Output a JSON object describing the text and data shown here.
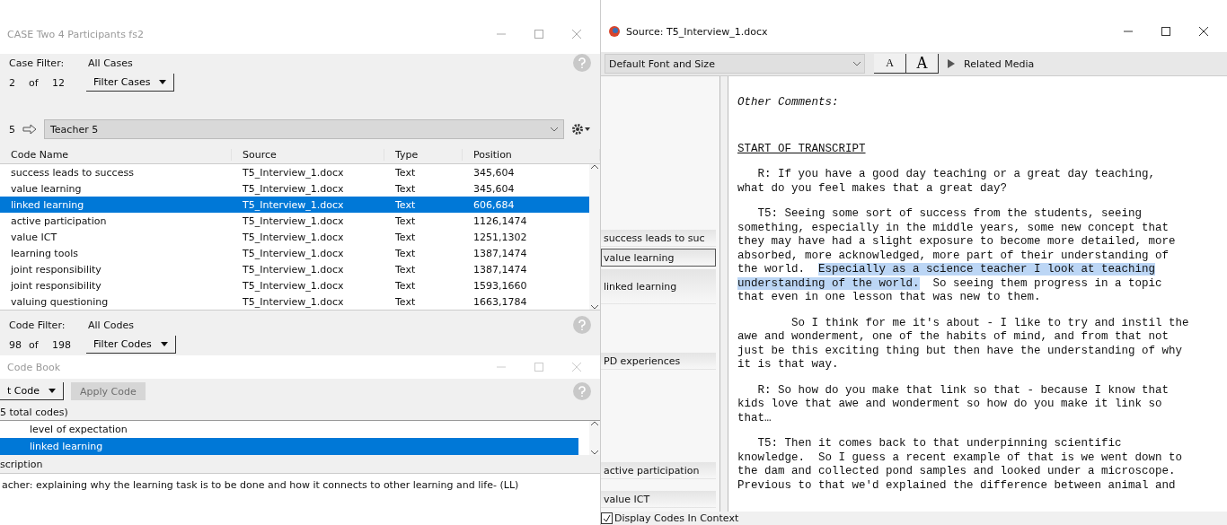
{
  "case_window": {
    "title": "CASE Two 4 Participants fs2",
    "case_filter": {
      "label": "Case Filter:",
      "value": "All Cases",
      "count": "2",
      "of": "of",
      "total": "12",
      "button": "Filter Cases"
    },
    "navigator": {
      "index": "5",
      "combo": "Teacher 5"
    },
    "table": {
      "columns": [
        "Code Name",
        "Source",
        "Type",
        "Position"
      ],
      "rows": [
        {
          "cells": [
            "success leads to success",
            "T5_Interview_1.docx",
            "Text",
            "345,604"
          ],
          "selected": false
        },
        {
          "cells": [
            "value learning",
            "T5_Interview_1.docx",
            "Text",
            "345,604"
          ],
          "selected": false
        },
        {
          "cells": [
            "linked learning",
            "T5_Interview_1.docx",
            "Text",
            "606,684"
          ],
          "selected": true
        },
        {
          "cells": [
            "active participation",
            "T5_Interview_1.docx",
            "Text",
            "1126,1474"
          ],
          "selected": false
        },
        {
          "cells": [
            "value ICT",
            "T5_Interview_1.docx",
            "Text",
            "1251,1302"
          ],
          "selected": false
        },
        {
          "cells": [
            "learning tools",
            "T5_Interview_1.docx",
            "Text",
            "1387,1474"
          ],
          "selected": false
        },
        {
          "cells": [
            "joint responsibility",
            "T5_Interview_1.docx",
            "Text",
            "1387,1474"
          ],
          "selected": false
        },
        {
          "cells": [
            "joint responsibility",
            "T5_Interview_1.docx",
            "Text",
            "1593,1660"
          ],
          "selected": false
        },
        {
          "cells": [
            "valuing questioning",
            "T5_Interview_1.docx",
            "Text",
            "1663,1784"
          ],
          "selected": false
        }
      ]
    },
    "code_filter": {
      "label": "Code Filter:",
      "value": "All Codes",
      "count": "98",
      "of": "of",
      "total": "198",
      "button": "Filter Codes"
    }
  },
  "code_book": {
    "title": "Code Book",
    "code_button": "t Code",
    "apply_button": {
      "label": "Apply Code",
      "disabled": true
    },
    "total": "5 total codes)",
    "items": [
      {
        "label": "level of expectation",
        "selected": false
      },
      {
        "label": "linked learning",
        "selected": true
      }
    ],
    "description_label": "scription",
    "description": "acher: explaining why the learning task is to be done and how it connects to other learning and life- (LL)"
  },
  "source_window": {
    "title": "Source: T5_Interview_1.docx",
    "font_combo": "Default Font and Size",
    "font_buttons": [
      {
        "label": "A",
        "kind": "small"
      },
      {
        "label": "A",
        "kind": "large"
      }
    ],
    "related_media": "Related Media",
    "margin_codes": [
      {
        "label": "success leads to suc",
        "selected": false
      },
      {
        "label": "value learning",
        "selected": true
      },
      {
        "label": "linked learning",
        "selected": false
      },
      {
        "label": "PD experiences",
        "selected": false
      },
      {
        "label": "active participation",
        "selected": false
      },
      {
        "label": "value ICT",
        "selected": false
      }
    ],
    "paragraphs": [
      {
        "kind": "italic",
        "segments": [
          {
            "text": "Other Comments:",
            "highlighted": false
          }
        ]
      },
      {
        "kind": "heading",
        "segments": [
          {
            "text": "START OF TRANSCRIPT",
            "highlighted": false
          }
        ]
      },
      {
        "kind": "body",
        "segments": [
          {
            "text": "   R: If you have a good day teaching or a great day teaching,\nwhat do you feel makes that a great day?",
            "highlighted": false
          }
        ]
      },
      {
        "kind": "body",
        "segments": [
          {
            "text": "   T5: Seeing some sort of success from the students, seeing\nsomething, especially in the middle years, some new concept that\nthey may have had a slight exposure to become more detailed, more\nabsorbed, more acknowledged, more part of their understanding of\nthe world.  ",
            "highlighted": false
          },
          {
            "text": "Especially as a science teacher I look at teaching\nunderstanding of the world.",
            "highlighted": true
          },
          {
            "text": "  So seeing them progress in a topic\nthat even in one lesson that was new to them.",
            "highlighted": false
          }
        ]
      },
      {
        "kind": "body",
        "segments": [
          {
            "text": "        So I think for me it's about - I like to try and instil the\nawe and wonderment, one of the habits of mind, and from that not\njust be this exciting thing but then have the understanding of why\nit is that way.",
            "highlighted": false
          }
        ]
      },
      {
        "kind": "body",
        "segments": [
          {
            "text": "   R: So how do you make that link so that - because I know that\nkids love that awe and wonderment so how do you make it link so\nthat…",
            "highlighted": false
          }
        ]
      },
      {
        "kind": "body",
        "segments": [
          {
            "text": "   T5: Then it comes back to that underpinning scientific\nknowledge.  So I guess a recent example of that is we went down to\nthe dam and collected pond samples and looked under a microscope.\nPrevious to that we'd explained the difference between animal and",
            "highlighted": false
          }
        ]
      }
    ],
    "display_codes": {
      "label": "Display Codes In Context",
      "checked": true
    }
  }
}
